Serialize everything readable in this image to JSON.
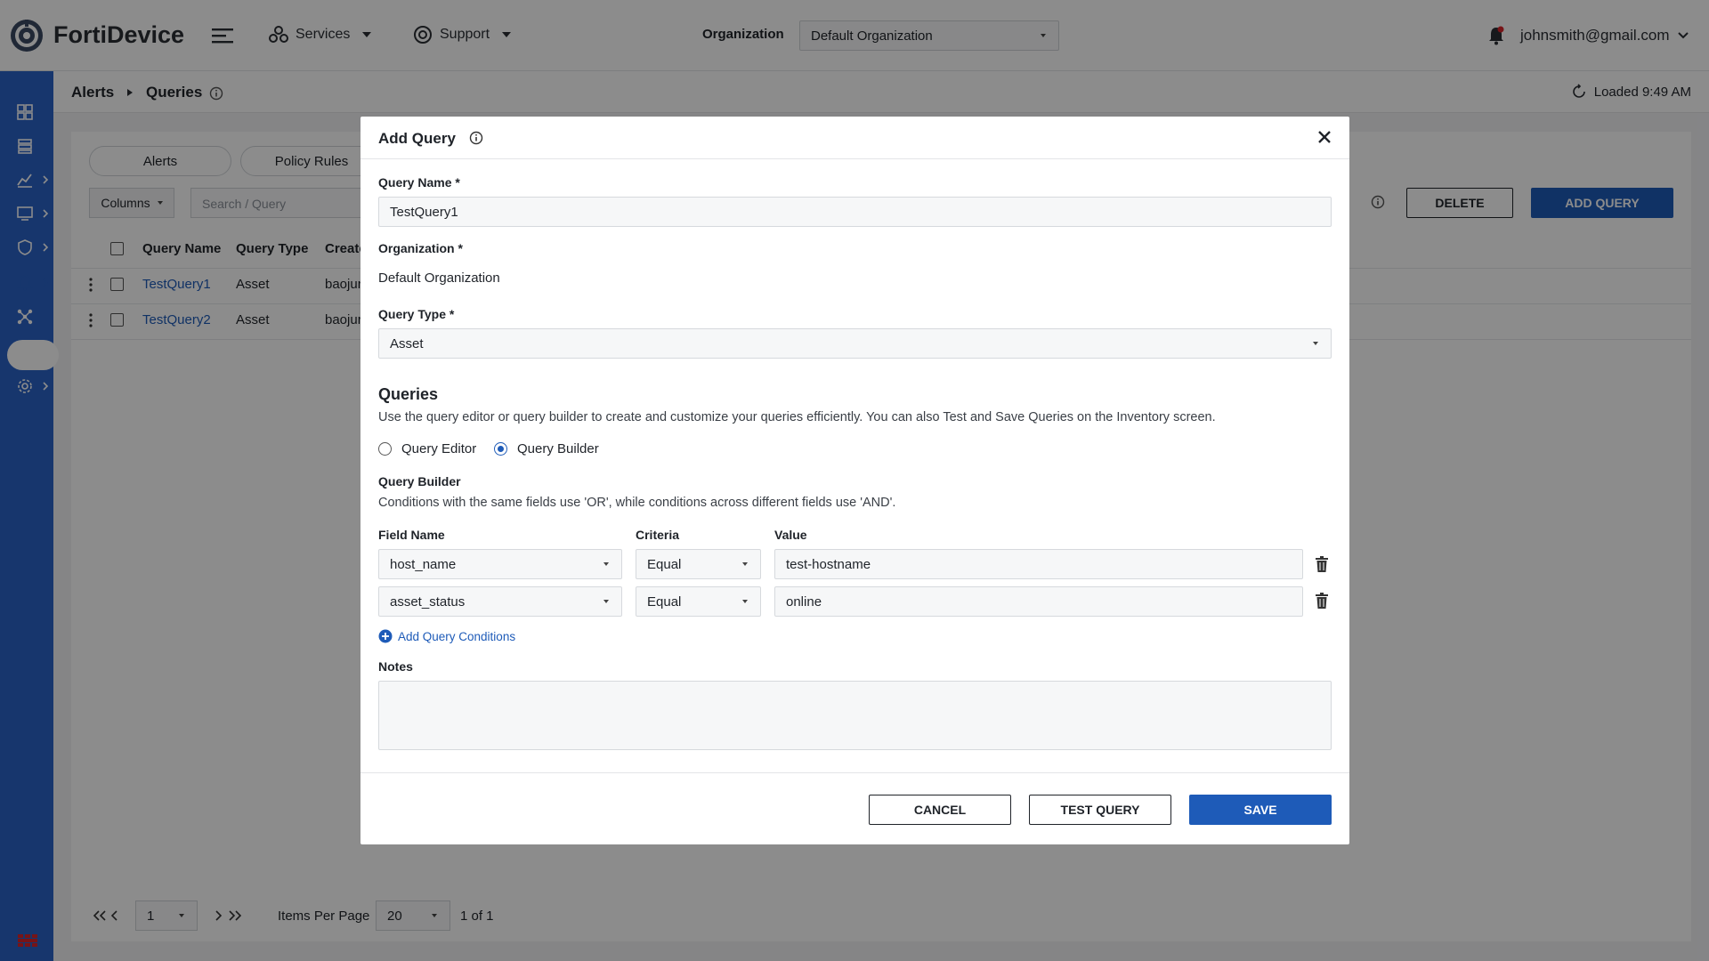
{
  "header": {
    "brand": "FortiDevice",
    "nav": [
      {
        "label": "Services"
      },
      {
        "label": "Support"
      }
    ],
    "org_label": "Organization",
    "org_value": "Default Organization",
    "user": "johnsmith@gmail.com"
  },
  "breadcrumb": {
    "parent": "Alerts",
    "current": "Queries",
    "loaded": "Loaded 9:49 AM"
  },
  "page": {
    "tabs": [
      "Alerts",
      "Policy Rules"
    ],
    "columns_label": "Columns",
    "search_placeholder": "Search / Query",
    "delete_label": "DELETE",
    "add_query_label": "ADD QUERY",
    "table_headers": [
      "Query Name",
      "Query Type",
      "Create"
    ],
    "rows": [
      {
        "name": "TestQuery1",
        "type": "Asset",
        "creator": "baojur"
      },
      {
        "name": "TestQuery2",
        "type": "Asset",
        "creator": "baojur"
      }
    ],
    "pager": {
      "page": "1",
      "items_per_page_label": "Items Per Page",
      "items_per_page": "20",
      "page_of": "1 of 1"
    }
  },
  "modal": {
    "title": "Add Query",
    "query_name_label": "Query Name *",
    "query_name_value": "TestQuery1",
    "organization_label": "Organization *",
    "organization_value": "Default Organization",
    "query_type_label": "Query Type *",
    "query_type_value": "Asset",
    "queries_title": "Queries",
    "queries_desc": "Use the query editor or query builder to create and customize your queries efficiently. You can also Test and Save Queries on the Inventory screen.",
    "radio_editor": "Query Editor",
    "radio_builder": "Query Builder",
    "builder_title": "Query Builder",
    "builder_desc": "Conditions with the same fields use 'OR', while conditions across different fields use 'AND'.",
    "col_field": "Field Name",
    "col_criteria": "Criteria",
    "col_value": "Value",
    "conditions": [
      {
        "field": "host_name",
        "criteria": "Equal",
        "value": "test-hostname"
      },
      {
        "field": "asset_status",
        "criteria": "Equal",
        "value": "online"
      }
    ],
    "add_conditions": "Add Query Conditions",
    "notes_label": "Notes",
    "cancel": "CANCEL",
    "test_query": "TEST QUERY",
    "save": "SAVE"
  },
  "colors": {
    "primary": "#1e5bb8",
    "sidebar": "#2a63c7",
    "brand_red": "#d9252a"
  }
}
